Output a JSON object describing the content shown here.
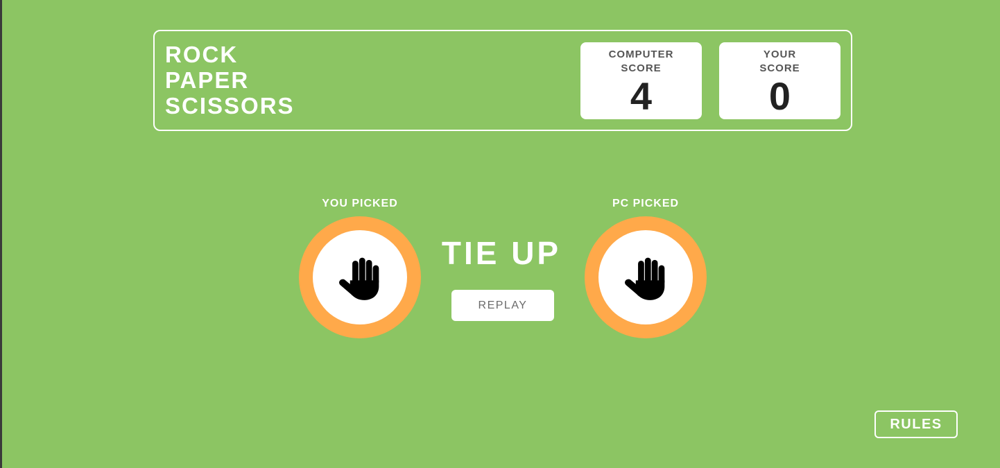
{
  "header": {
    "title_lines": [
      "ROCK",
      "PAPER",
      "SCISSORS"
    ],
    "computer_score": {
      "label_lines": [
        "COMPUTER",
        "SCORE"
      ],
      "value": "4"
    },
    "your_score": {
      "label_lines": [
        "YOUR",
        "SCORE"
      ],
      "value": "0"
    }
  },
  "game": {
    "you_picked_label": "YOU PICKED",
    "pc_picked_label": "PC PICKED",
    "you_pick_icon": "hand-paper-icon",
    "pc_pick_icon": "hand-paper-icon",
    "result_text": "TIE UP",
    "replay_label": "REPLAY"
  },
  "rules_label": "RULES",
  "colors": {
    "background": "#8cc563",
    "pick_ring": "#ffa94a",
    "card": "#ffffff",
    "text_on_bg": "#ffffff"
  }
}
